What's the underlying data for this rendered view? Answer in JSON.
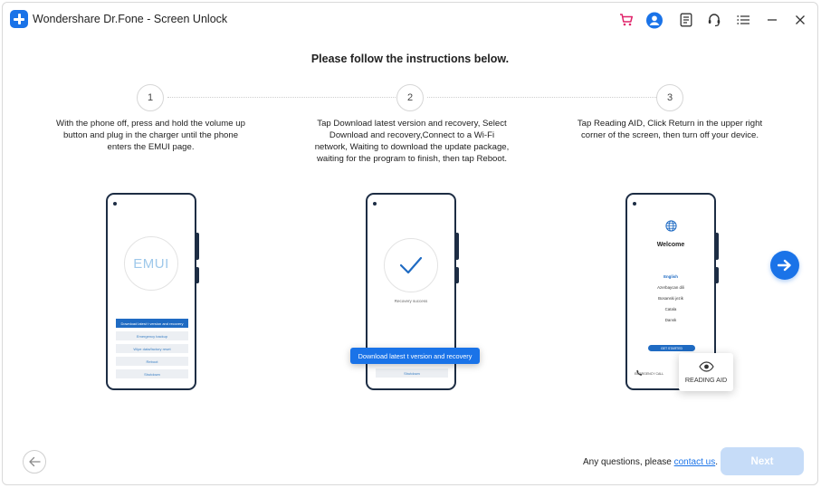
{
  "window": {
    "title": "Wondershare Dr.Fone - Screen Unlock"
  },
  "toolbar": {
    "icons": [
      "cart-icon",
      "account-icon",
      "feedback-icon",
      "support-icon",
      "menu-icon",
      "minimize-icon",
      "close-icon"
    ]
  },
  "heading": "Please follow the instructions below.",
  "steps": [
    {
      "number": "1",
      "text": "With the phone off, press and hold the volume up button and plug in the charger until the phone enters the EMUI page."
    },
    {
      "number": "2",
      "text": "Tap Download latest version and recovery, Select Download and recovery,Connect to a Wi-Fi network, Waiting to download the update package, waiting for the program to finish, then tap Reboot."
    },
    {
      "number": "3",
      "text": "Tap Reading AID, Click Return in the upper right corner of the screen, then turn off your device."
    }
  ],
  "phone1": {
    "logo": "EMUI",
    "menu": [
      "Download latest t version and recovery",
      "Emergency backup",
      "Wipe data/factory reset",
      "Reboot",
      "Shutdown"
    ]
  },
  "phone2": {
    "caption": "Recovery success",
    "bottom": "Shutdown",
    "popup": "Download latest t version and recovery"
  },
  "phone3": {
    "welcome": "Welcome",
    "languages": [
      "English",
      "Azerbaycan dili",
      "Bosanski jezik",
      "Catala",
      "Dansk"
    ],
    "get_started": "GET STARTED",
    "emergency": "EMERGENCY CALL",
    "reading_aid": "READING AID"
  },
  "footer": {
    "question": "Any questions, please ",
    "contact_link": "contact us",
    "period": ".",
    "next_label": "Next"
  },
  "colors": {
    "accent": "#1a73e8",
    "next_disabled": "#c6dcf8",
    "phone_frame": "#1d2d44"
  }
}
